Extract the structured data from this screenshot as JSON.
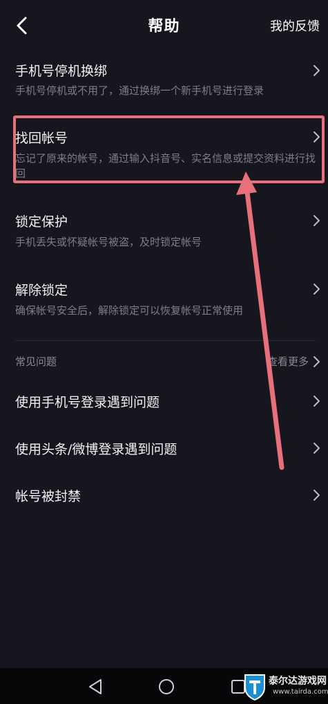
{
  "header": {
    "title": "帮助",
    "feedback_label": "我的反馈"
  },
  "items": [
    {
      "title": "手机号停机换绑",
      "desc": "手机号停机或不用了，通过换绑一个新手机号进行登录"
    },
    {
      "title": "找回帐号",
      "desc": "忘记了原来的帐号，通过输入抖音号、实名信息或提交资料进行找回"
    },
    {
      "title": "锁定保护",
      "desc": "手机丢失或怀疑帐号被盗，及时锁定帐号"
    },
    {
      "title": "解除锁定",
      "desc": "确保帐号安全后，解除锁定可以恢复帐号正常使用"
    }
  ],
  "faq": {
    "label": "常见问题",
    "more_label": "查看更多",
    "items": [
      {
        "title": "使用手机号登录遇到问题"
      },
      {
        "title": "使用头条/微博登录遇到问题"
      },
      {
        "title": "帐号被封禁"
      }
    ]
  },
  "watermark": {
    "name": "泰尔达游戏网",
    "url": "www.tairda.com"
  },
  "colors": {
    "background": "#16161f",
    "annotation": "#e8707a",
    "secondary_text": "#7e7e88"
  }
}
